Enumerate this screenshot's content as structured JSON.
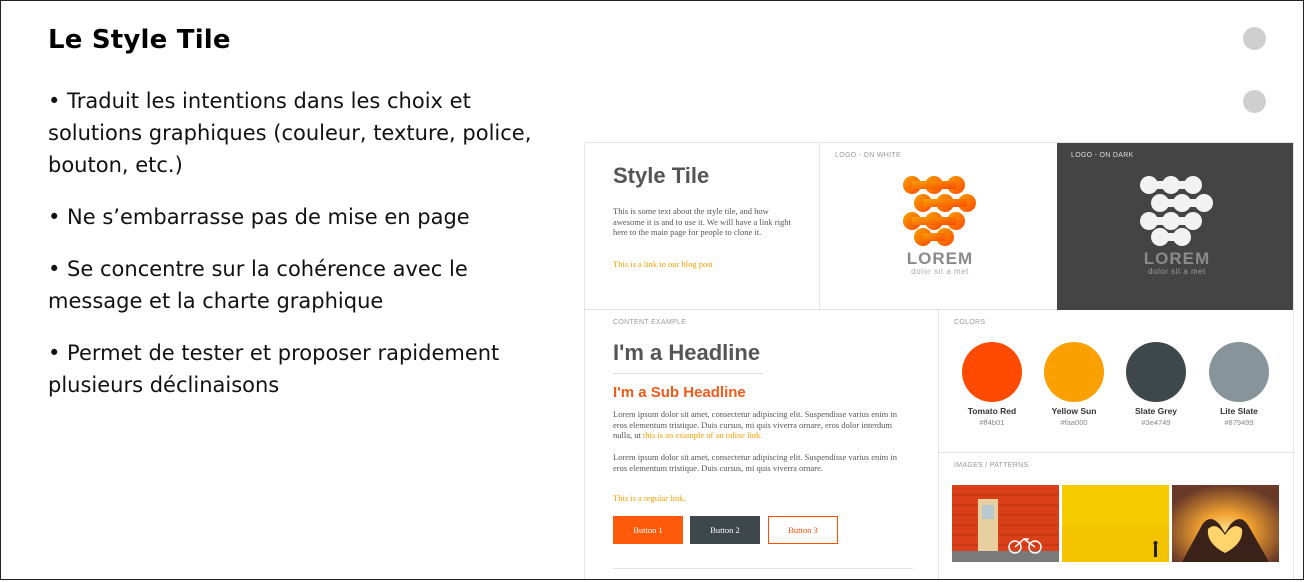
{
  "slide": {
    "title": "Le Style Tile",
    "bullets": [
      "• Traduit les intentions dans les choix et solutions graphiques (couleur, texture, police, bouton, etc.)",
      "• Ne s’embarrasse pas de mise en page",
      "• Se concentre sur la cohérence avec le message et la charte graphique",
      "• Permet de tester et proposer rapidement plusieurs déclinaisons"
    ]
  },
  "tile": {
    "title": "Style Tile",
    "intro_text": "This is some text about the style tile, and how awesome it is and to use it. We will have a link right here to the main page for people to clone it.",
    "intro_link": "This is a link to our blog post",
    "logo_white_caption": "LOGO - ON WHITE",
    "logo_dark_caption": "LOGO - ON DARK",
    "logo_name": "LOREM",
    "logo_tagline": "dolor sit a met",
    "content_caption": "CONTENT EXAMPLE",
    "headline": "I'm a Headline",
    "subheadline": "I'm a Sub Headline",
    "para1": "Lorem ipsum dolor sit amet, consectetur adipiscing elit. Suspendisse varius enim in eros elementum tristique. Duis cursus, mi quis viverra ornare, eros dolor interdum nulla, ut",
    "para1_link": "this is an example of an inline link.",
    "para2": "Lorem ipsum dolor sit amet, consectetur adipiscing elit. Suspendisse varius enim in eros elementum tristique. Duis cursus, mi quis viverra ornare.",
    "regular_link": "This is a regular link.",
    "buttons": [
      "Button 1",
      "Button 2",
      "Button 3"
    ],
    "colors_caption": "COLORS",
    "colors": [
      {
        "name": "Tomato Red",
        "hex": "#ff4b01"
      },
      {
        "name": "Yellow Sun",
        "hex": "#faa000"
      },
      {
        "name": "Slate Grey",
        "hex": "#3e4749"
      },
      {
        "name": "Lite Slate",
        "hex": "#879499"
      }
    ],
    "images_caption": "IMAGES / PATTERNS"
  },
  "style_colors": {
    "orange": "#ff5a0a",
    "yellow": "#f5a000",
    "dark_panel": "#444444",
    "nav_dot": "#cfcfcf"
  },
  "icons": [
    "nav-dot-icon",
    "lorem-logo-icon"
  ]
}
